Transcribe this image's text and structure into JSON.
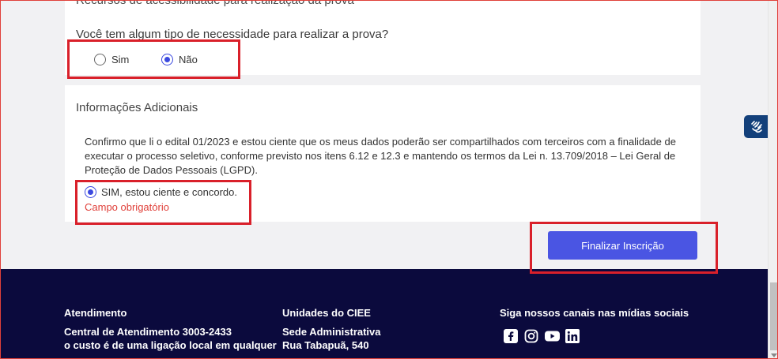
{
  "accessibility": {
    "section_title": "Recursos de acessibilidade para realização da prova",
    "question": "Você tem algum tipo de necessidade para realizar a prova?",
    "options": [
      {
        "label": "Sim",
        "selected": false
      },
      {
        "label": "Não",
        "selected": true
      }
    ]
  },
  "additional_info": {
    "title": "Informações Adicionais",
    "text": "Confirmo que li o edital 01/2023 e estou ciente que os meus dados poderão ser compartilhados com terceiros com a finalidade de executar o processo seletivo, conforme previsto nos itens 6.12 e 12.3 e mantendo os termos da Lei n. 13.709/2018 – Lei Geral de Proteção de Dados Pessoais (LGPD).",
    "agree_label": "SIM, estou ciente e concordo.",
    "agree_selected": true,
    "required_message": "Campo obrigatório"
  },
  "submit": {
    "label": "Finalizar Inscrição"
  },
  "footer": {
    "atendimento": {
      "heading": "Atendimento",
      "line1_prefix": "Central de Atendimento ",
      "line1_number": "3003-2433",
      "line2": "o custo é de uma ligação local em qualquer"
    },
    "unidades": {
      "heading": "Unidades do CIEE",
      "line1": "Sede Administrativa",
      "line2": "Rua Tabapuã, 540"
    },
    "social": {
      "heading": "Siga nossos canais nas mídias sociais",
      "icons": [
        "facebook-icon",
        "instagram-icon",
        "youtube-icon",
        "linkedin-icon"
      ]
    }
  },
  "colors": {
    "accent": "#4a55e3",
    "footer_bg": "#0b0a3d",
    "error": "#e0403a",
    "highlight": "#d9202a"
  }
}
